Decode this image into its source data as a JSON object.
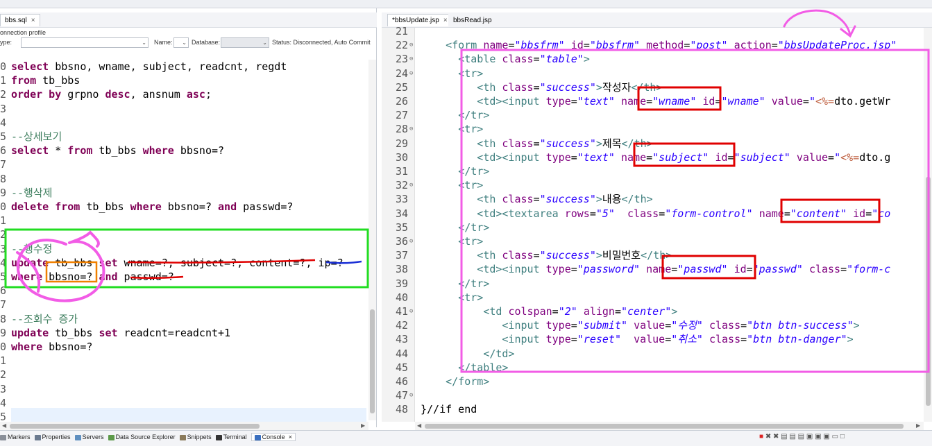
{
  "left": {
    "tab": {
      "label": "bbs.sql",
      "close": "×"
    },
    "connection_profile_label": "onnection profile",
    "type_label": "ype:",
    "name_label": "Name:",
    "database_label": "Database:",
    "status_text": "Status: Disconnected, Auto Commit",
    "sql_lines": [
      {
        "num": "0",
        "html": "<span class='kw'>select</span> bbsno, wname, subject, readcnt, regdt"
      },
      {
        "num": "1",
        "html": "<span class='kw'>from</span> tb_bbs"
      },
      {
        "num": "2",
        "html": "<span class='kw'>order by</span> grpno <span class='kw'>desc</span>, ansnum <span class='kw'>asc</span>;"
      },
      {
        "num": "3",
        "html": ""
      },
      {
        "num": "4",
        "html": ""
      },
      {
        "num": "5",
        "html": "<span class='cmt'>--상세보기</span>"
      },
      {
        "num": "6",
        "html": "<span class='kw'>select</span> * <span class='kw'>from</span> tb_bbs <span class='kw'>where</span> bbsno=?"
      },
      {
        "num": "7",
        "html": ""
      },
      {
        "num": "8",
        "html": ""
      },
      {
        "num": "9",
        "html": "<span class='cmt'>--행삭제</span>"
      },
      {
        "num": "0",
        "html": "<span class='kw'>delete</span> <span class='kw'>from</span> tb_bbs <span class='kw'>where</span> bbsno=? <span class='kw'>and</span> passwd=?"
      },
      {
        "num": "1",
        "html": ""
      },
      {
        "num": "2",
        "html": ""
      },
      {
        "num": "3",
        "html": "<span class='cmt'>--행수정</span>"
      },
      {
        "num": "4",
        "html": "<span class='kw'>update</span> tb_bbs <span class='kw'>set</span> wname=?, subject=?, content=?, ip=?"
      },
      {
        "num": "5",
        "html": "<span class='kw'>where</span> bbsno=? <span class='kw'>and</span> passwd=?"
      },
      {
        "num": "6",
        "html": ""
      },
      {
        "num": "7",
        "html": ""
      },
      {
        "num": "8",
        "html": "<span class='cmt'>--조회수 증가</span>"
      },
      {
        "num": "9",
        "html": "<span class='kw'>update</span> tb_bbs <span class='kw'>set</span> readcnt=readcnt+1"
      },
      {
        "num": "0",
        "html": "<span class='kw'>where</span> bbsno=?"
      },
      {
        "num": "1",
        "html": ""
      },
      {
        "num": "2",
        "html": ""
      },
      {
        "num": "3",
        "html": ""
      },
      {
        "num": "4",
        "html": ""
      },
      {
        "num": "5",
        "html": ""
      }
    ]
  },
  "right": {
    "tabs": [
      {
        "label": "*bbsUpdate.jsp",
        "close": "×"
      },
      {
        "label": "bbsRead.jsp",
        "close": ""
      }
    ],
    "jsp_lines": [
      {
        "num": "21",
        "fold": "",
        "html": ""
      },
      {
        "num": "22",
        "fold": "⊖",
        "html": "    <span class='tag'>&lt;form</span> <span class='attr'>name</span>=<span class='val'>\"bbsfrm\"</span> <span class='attr'>id</span>=<span class='val'>\"bbsfrm\"</span> <span class='attr'>method</span>=<span class='val'>\"post\"</span> <span class='attr'>action</span>=<span class='val'>\"bbsUpdateProc.jsp\"</span>"
      },
      {
        "num": "23",
        "fold": "⊖",
        "html": "      <span class='tag'>&lt;table</span> <span class='attr'>class</span>=<span class='val'>\"table\"</span><span class='tag'>&gt;</span>"
      },
      {
        "num": "24",
        "fold": "⊖",
        "html": "      <span class='tag'>&lt;tr&gt;</span>"
      },
      {
        "num": "25",
        "fold": "",
        "html": "         <span class='tag'>&lt;th</span> <span class='attr'>class</span>=<span class='val'>\"success\"</span><span class='tag'>&gt;</span><span class='txt'>작성자</span><span class='tag'>&lt;/th&gt;</span>"
      },
      {
        "num": "26",
        "fold": "",
        "html": "         <span class='tag'>&lt;td&gt;&lt;input</span> <span class='attr'>type</span>=<span class='val'>\"text\"</span> <span class='attr'>name</span>=<span class='val'>\"wname\"</span> <span class='attr'>id</span>=<span class='val'>\"wname\"</span> <span class='attr'>value</span>=<span class='val'>\"</span><span class='jsp'>&lt;%=</span>dto.getWr"
      },
      {
        "num": "27",
        "fold": "",
        "html": "      <span class='tag'>&lt;/tr&gt;</span>"
      },
      {
        "num": "28",
        "fold": "⊖",
        "html": "      <span class='tag'>&lt;tr&gt;</span>"
      },
      {
        "num": "29",
        "fold": "",
        "html": "         <span class='tag'>&lt;th</span> <span class='attr'>class</span>=<span class='val'>\"success\"</span><span class='tag'>&gt;</span><span class='txt'>제목</span><span class='tag'>&lt;/th&gt;</span>"
      },
      {
        "num": "30",
        "fold": "",
        "html": "         <span class='tag'>&lt;td&gt;&lt;input</span> <span class='attr'>type</span>=<span class='val'>\"text\"</span> <span class='attr'>name</span>=<span class='val'>\"subject\"</span> <span class='attr'>id</span>=<span class='val'>\"subject\"</span> <span class='attr'>value</span>=<span class='val'>\"</span><span class='jsp'>&lt;%=</span>dto.g"
      },
      {
        "num": "31",
        "fold": "",
        "html": "      <span class='tag'>&lt;/tr&gt;</span>"
      },
      {
        "num": "32",
        "fold": "⊖",
        "html": "      <span class='tag'>&lt;tr&gt;</span>"
      },
      {
        "num": "33",
        "fold": "",
        "html": "         <span class='tag'>&lt;th</span> <span class='attr'>class</span>=<span class='val'>\"success\"</span><span class='tag'>&gt;</span><span class='txt'>내용</span><span class='tag'>&lt;/th&gt;</span>"
      },
      {
        "num": "34",
        "fold": "",
        "html": "         <span class='tag'>&lt;td&gt;&lt;textarea</span> <span class='attr'>rows</span>=<span class='val'>\"5\"</span>  <span class='attr'>class</span>=<span class='val'>\"form-control\"</span> <span class='attr'>name</span>=<span class='val'>\"content\"</span> <span class='attr'>id</span>=<span class='val'>\"co</span>"
      },
      {
        "num": "35",
        "fold": "",
        "html": "      <span class='tag'>&lt;/tr&gt;</span>"
      },
      {
        "num": "36",
        "fold": "⊖",
        "html": "      <span class='tag'>&lt;tr&gt;</span>"
      },
      {
        "num": "37",
        "fold": "",
        "html": "         <span class='tag'>&lt;th</span> <span class='attr'>class</span>=<span class='val'>\"success\"</span><span class='tag'>&gt;</span><span class='txt'>비밀번호</span><span class='tag'>&lt;/th&gt;</span>"
      },
      {
        "num": "38",
        "fold": "",
        "html": "         <span class='tag'>&lt;td&gt;&lt;input</span> <span class='attr'>type</span>=<span class='val'>\"password\"</span> <span class='attr'>name</span>=<span class='val'>\"passwd\"</span> <span class='attr'>id</span>=<span class='val'>\"passwd\"</span> <span class='attr'>class</span>=<span class='val'>\"form-c</span>"
      },
      {
        "num": "39",
        "fold": "",
        "html": "      <span class='tag'>&lt;/tr&gt;</span>"
      },
      {
        "num": "40",
        "fold": "",
        "html": "      <span class='tag'>&lt;tr&gt;</span>"
      },
      {
        "num": "41",
        "fold": "⊖",
        "html": "          <span class='tag'>&lt;td</span> <span class='attr'>colspan</span>=<span class='val'>\"2\"</span> <span class='attr'>align</span>=<span class='val'>\"center\"</span><span class='tag'>&gt;</span>"
      },
      {
        "num": "42",
        "fold": "",
        "html": "             <span class='tag'>&lt;input</span> <span class='attr'>type</span>=<span class='val'>\"submit\"</span> <span class='attr'>value</span>=<span class='val'>\"수정\"</span> <span class='attr'>class</span>=<span class='val'>\"btn btn-success\"</span><span class='tag'>&gt;</span>"
      },
      {
        "num": "43",
        "fold": "",
        "html": "             <span class='tag'>&lt;input</span> <span class='attr'>type</span>=<span class='val'>\"reset\"</span>  <span class='attr'>value</span>=<span class='val'>\"취소\"</span> <span class='attr'>class</span>=<span class='val'>\"btn btn-danger\"</span><span class='tag'>&gt;</span>"
      },
      {
        "num": "44",
        "fold": "",
        "html": "          <span class='tag'>&lt;/td&gt;</span>"
      },
      {
        "num": "45",
        "fold": "",
        "html": "      <span class='tag'>&lt;/table&gt;</span>"
      },
      {
        "num": "46",
        "fold": "",
        "html": "    <span class='tag'>&lt;/form&gt;</span>"
      },
      {
        "num": "47",
        "fold": "⊖",
        "html": ""
      },
      {
        "num": "48",
        "fold": "",
        "html": "<span class='txt'>}//if end</span>"
      }
    ]
  },
  "bottom": {
    "tabs": [
      {
        "label": "Markers",
        "color": "#8a8f99"
      },
      {
        "label": "Properties",
        "color": "#6b7a8f"
      },
      {
        "label": "Servers",
        "color": "#5f8fbf"
      },
      {
        "label": "Data Source Explorer",
        "color": "#5d9a4a"
      },
      {
        "label": "Snippets",
        "color": "#8a7a5a"
      },
      {
        "label": "Terminal",
        "color": "#333333"
      },
      {
        "label": "Console",
        "color": "#3a6fbf",
        "active": true
      }
    ],
    "close": "×"
  },
  "colors": {
    "annotation_green": "#22dd22",
    "annotation_red": "#e00000",
    "annotation_pink": "#f25ce6",
    "annotation_blue": "#1a2fd6",
    "annotation_orange": "#f08000",
    "sql_keyword": "#7f0055",
    "sql_comment": "#3f7f5f"
  }
}
